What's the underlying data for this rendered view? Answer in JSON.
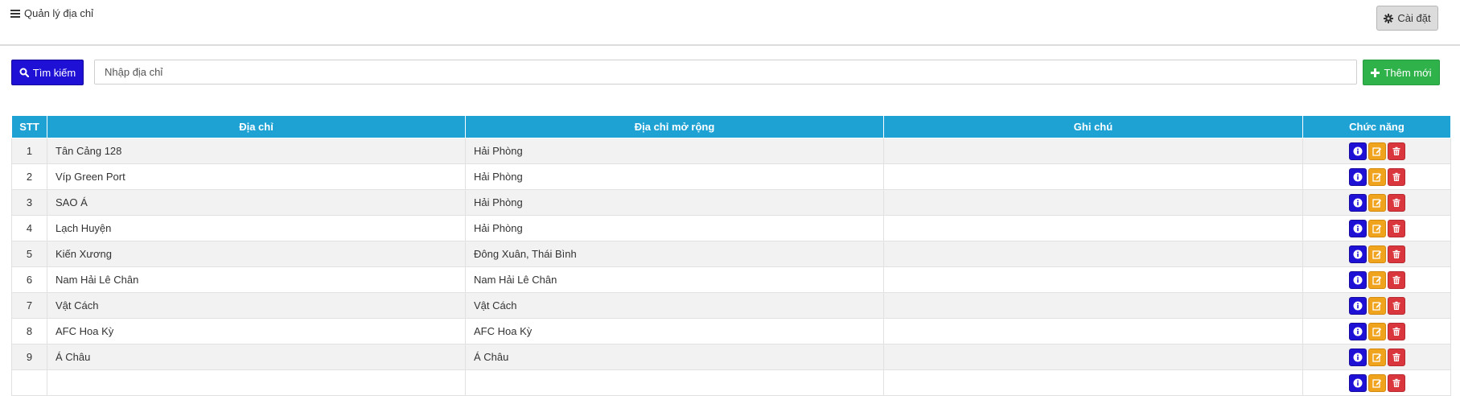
{
  "header": {
    "title": "Quản lý địa chỉ",
    "settings_label": "Cài đặt"
  },
  "toolbar": {
    "search_label": "Tìm kiếm",
    "search_placeholder": "Nhập địa chỉ",
    "add_label": "Thêm mới"
  },
  "table": {
    "columns": [
      "STT",
      "Địa chỉ",
      "Địa chỉ mở rộng",
      "Ghi chú",
      "Chức năng"
    ],
    "rows": [
      {
        "stt": "1",
        "address": "Tân Cảng 128",
        "extended": "Hải Phòng",
        "note": ""
      },
      {
        "stt": "2",
        "address": "Víp Green Port",
        "extended": "Hải Phòng",
        "note": ""
      },
      {
        "stt": "3",
        "address": "SAO Á",
        "extended": "Hải Phòng",
        "note": ""
      },
      {
        "stt": "4",
        "address": "Lạch Huyện",
        "extended": "Hải Phòng",
        "note": ""
      },
      {
        "stt": "5",
        "address": "Kiến Xương",
        "extended": "Đông Xuân, Thái Bình",
        "note": ""
      },
      {
        "stt": "6",
        "address": "Nam Hải Lê Chân",
        "extended": "Nam Hải Lê Chân",
        "note": ""
      },
      {
        "stt": "7",
        "address": "Vật Cách",
        "extended": "Vật Cách",
        "note": ""
      },
      {
        "stt": "8",
        "address": "AFC Hoa Kỳ",
        "extended": "AFC Hoa Kỳ",
        "note": ""
      },
      {
        "stt": "9",
        "address": "Á Châu",
        "extended": "Á Châu",
        "note": ""
      },
      {
        "stt": "",
        "address": "",
        "extended": "",
        "note": ""
      }
    ],
    "action_icons": [
      "info-icon",
      "edit-icon",
      "trash-icon"
    ]
  },
  "colors": {
    "primary": "#1f10d6",
    "success": "#2fb24a",
    "header_bg": "#1ea2d4",
    "warning": "#f0a31c",
    "danger": "#d9363e"
  }
}
